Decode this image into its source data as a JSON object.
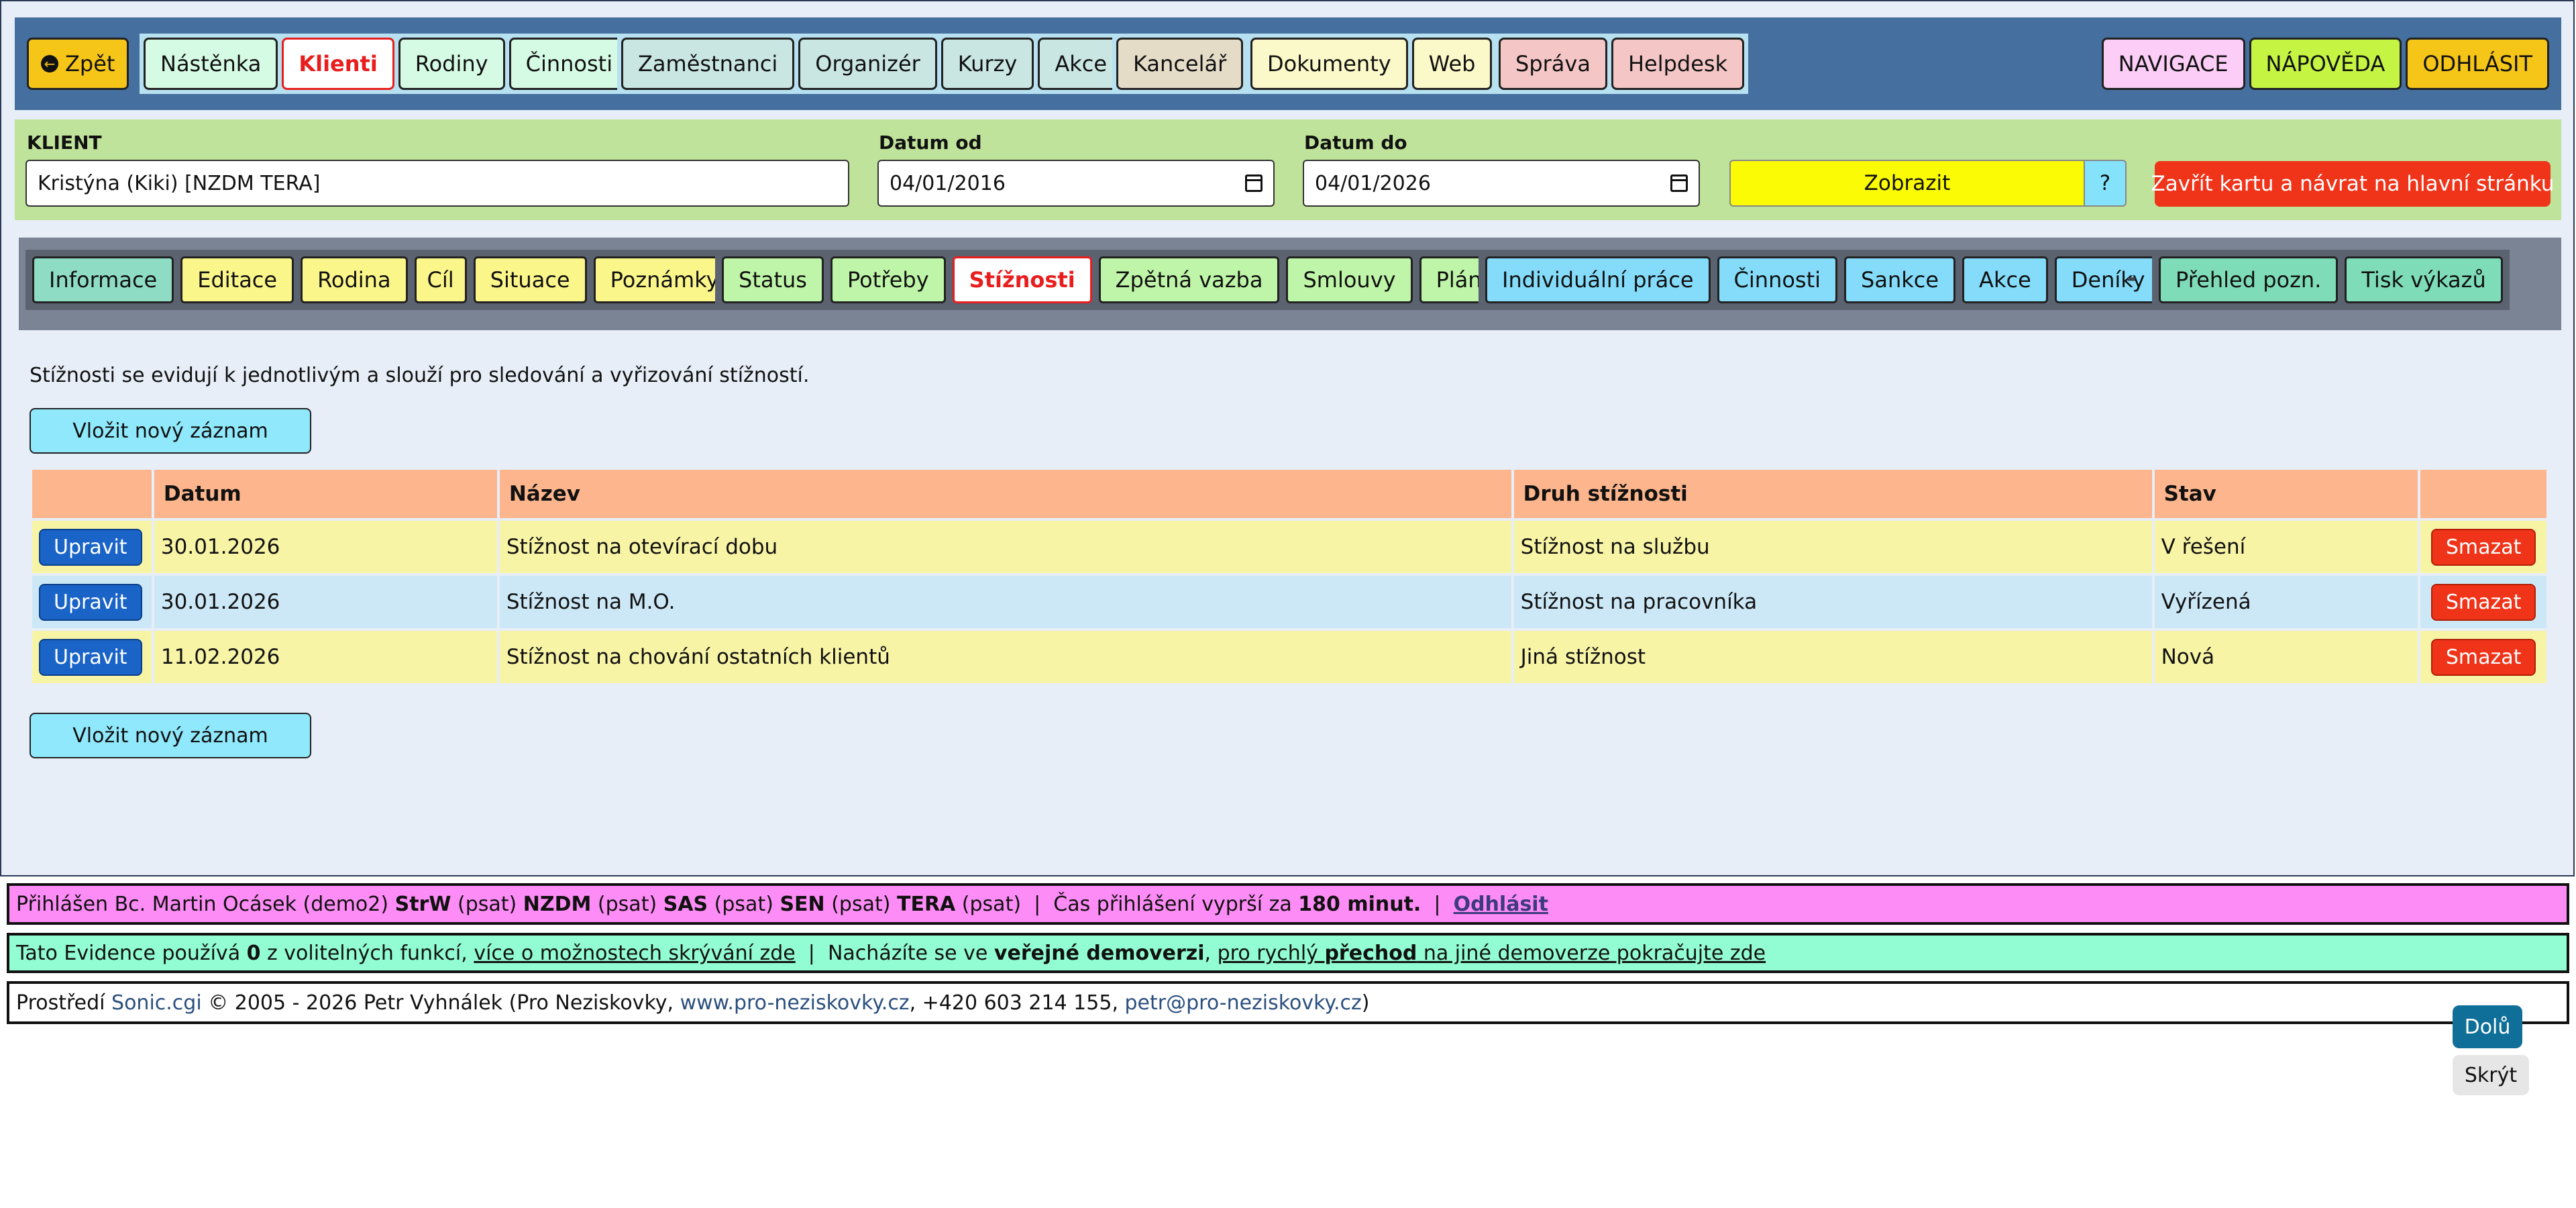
{
  "topnav": {
    "back": "Zpět",
    "back_icon": "arrow-left-circle-icon",
    "group1": [
      "Nástěnka",
      "Klienti",
      "Rodiny",
      "Činnosti"
    ],
    "group2": [
      "Zaměstnanci",
      "Organizér",
      "Kurzy",
      "Akce"
    ],
    "group3": [
      "Kancelář"
    ],
    "group4": [
      "Dokumenty",
      "Web"
    ],
    "group5": [
      "Správa",
      "Helpdesk"
    ],
    "right": [
      "NAVIGACE",
      "NÁPOVĚDA",
      "ODHLÁSIT"
    ],
    "active": "Klienti"
  },
  "clientbar": {
    "client_label": "KLIENT",
    "client_value": "Kristýna (Kiki) [NZDM TERA]",
    "date_from_label": "Datum od",
    "date_from_value": "04/01/2016",
    "date_to_label": "Datum do",
    "date_to_value": "04/01/2026",
    "show_button": "Zobrazit",
    "help_button": "?",
    "close_button": "Zavřít kartu a návrat na hlavní stránku"
  },
  "subnav": {
    "group1": [
      "Informace",
      "Editace",
      "Rodina",
      "Cíl",
      "Situace",
      "Poznámky"
    ],
    "group2": [
      "Status",
      "Potřeby",
      "Stížnosti",
      "Zpětná vazba",
      "Smlouvy",
      "Plány"
    ],
    "group3": [
      "Individuální práce",
      "Činnosti",
      "Sankce",
      "Akce",
      "Deníky"
    ],
    "separator": "-",
    "group4": [
      "Přehled pozn.",
      "Tisk výkazů"
    ],
    "active": "Stížnosti"
  },
  "content": {
    "intro": "Stížnosti se evidují k jednotlivým a slouží pro sledování a vyřizování stížností.",
    "new_button": "Vložit nový záznam",
    "columns": [
      "",
      "Datum",
      "Název",
      "Druh stížnosti",
      "Stav",
      ""
    ],
    "edit_label": "Upravit",
    "delete_label": "Smazat",
    "rows": [
      {
        "date": "30.01.2026",
        "name": "Stížnost na otevírací dobu",
        "type": "Stížnost na službu",
        "state": "V řešení"
      },
      {
        "date": "30.01.2026",
        "name": "Stížnost na M.O.",
        "type": "Stížnost na pracovníka",
        "state": "Vyřízená"
      },
      {
        "date": "11.02.2026",
        "name": "Stížnost na chování ostatních klientů",
        "type": "Jiná stížnost",
        "state": "Nová"
      }
    ]
  },
  "footer": {
    "login": {
      "prefix": "Přihlášen Bc. Martin Ocásek (demo2) ",
      "roles": [
        {
          "name": "StrW",
          "note": " (psat) "
        },
        {
          "name": "NZDM",
          "note": " (psat) "
        },
        {
          "name": "SAS",
          "note": " (psat) "
        },
        {
          "name": "SEN",
          "note": " (psat) "
        },
        {
          "name": "TERA",
          "note": " (psat)  |  "
        }
      ],
      "expire_text": "Čas přihlášení vyprší za ",
      "expire_value": "180 minut.",
      "sep": "  |  ",
      "logout": "Odhlásit"
    },
    "evidence": {
      "t1": "Tato Evidence používá ",
      "count": "0",
      "t2": " z volitelných funkcí, ",
      "link1": "více o možnostech skrývání zde",
      "t3": "  |  Nacházíte se ve ",
      "bold": "veřejné demoverzi",
      "t4": ", ",
      "link2a": "pro rychlý ",
      "link2b": "přechod",
      "link2c": " na jiné demoverze pokračujte zde"
    },
    "copyright": {
      "t1": "Prostředí ",
      "sonic": "Sonic.cgi",
      "t2": " © 2005 - 2026 Petr Vyhnálek (Pro Neziskovky, ",
      "web": "www.pro-neziskovky.cz",
      "t3": ", +420 603 214 155, ",
      "email": "petr@pro-neziskovky.cz",
      "t4": ")"
    }
  },
  "floating": {
    "down": "Dolů",
    "hide": "Skrýt"
  },
  "colors": {
    "nav_bg": "#456f9e",
    "client_bar": "#bfe39a",
    "active_red": "#e81e1e",
    "header_orange": "#fcb58c",
    "row_yellow": "#f8f4a6",
    "row_blue": "#cce8f7"
  }
}
